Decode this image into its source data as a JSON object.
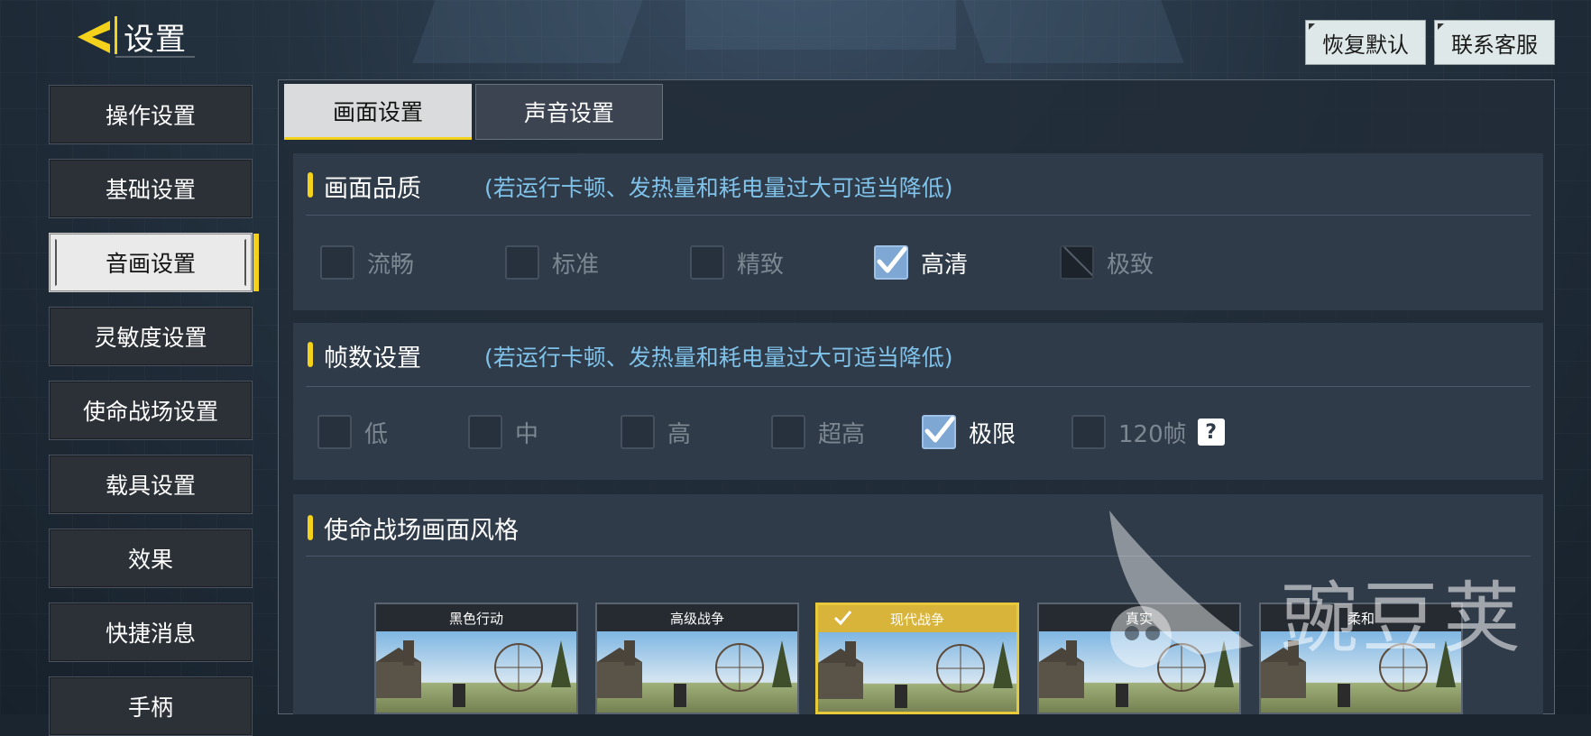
{
  "header": {
    "title": "设置",
    "restore_default": "恢复默认",
    "contact_support": "联系客服"
  },
  "sidebar": {
    "items": [
      {
        "label": "操作设置"
      },
      {
        "label": "基础设置"
      },
      {
        "label": "音画设置",
        "active": true
      },
      {
        "label": "灵敏度设置"
      },
      {
        "label": "使命战场设置"
      },
      {
        "label": "载具设置"
      },
      {
        "label": "效果"
      },
      {
        "label": "快捷消息"
      },
      {
        "label": "手柄"
      }
    ]
  },
  "tabs": [
    {
      "label": "画面设置",
      "active": true
    },
    {
      "label": "声音设置"
    }
  ],
  "quality": {
    "title": "画面品质",
    "hint": "(若运行卡顿、发热量和耗电量过大可适当降低)",
    "options": [
      {
        "label": "流畅",
        "state": "off"
      },
      {
        "label": "标准",
        "state": "off"
      },
      {
        "label": "精致",
        "state": "off"
      },
      {
        "label": "高清",
        "state": "on"
      },
      {
        "label": "极致",
        "state": "disabled"
      }
    ]
  },
  "framerate": {
    "title": "帧数设置",
    "hint": "(若运行卡顿、发热量和耗电量过大可适当降低)",
    "options": [
      {
        "label": "低",
        "state": "off"
      },
      {
        "label": "中",
        "state": "off"
      },
      {
        "label": "高",
        "state": "off"
      },
      {
        "label": "超高",
        "state": "off"
      },
      {
        "label": "极限",
        "state": "on"
      },
      {
        "label": "120帧",
        "state": "off"
      }
    ],
    "help_glyph": "?"
  },
  "style": {
    "title": "使命战场画面风格",
    "cards": [
      {
        "label": "黑色行动"
      },
      {
        "label": "高级战争"
      },
      {
        "label": "现代战争",
        "selected": true
      },
      {
        "label": "真实"
      },
      {
        "label": "柔和"
      }
    ]
  },
  "watermark": {
    "text": "豌豆荚"
  },
  "colors": {
    "accent": "#f4d11a",
    "hint": "#7fc2ea",
    "checked": "#7fa7d3"
  },
  "icons": {
    "back": "back-arrow-icon",
    "check": "check-icon",
    "help": "question-icon"
  }
}
